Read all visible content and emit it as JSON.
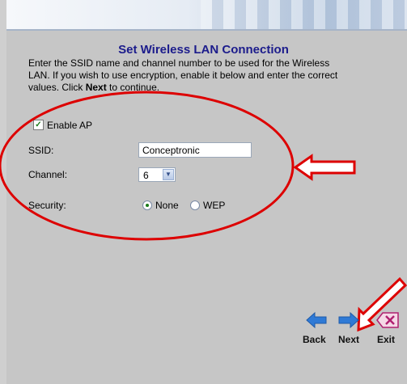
{
  "title": "Set Wireless LAN Connection",
  "description": {
    "line1": "Enter the SSID name and channel number to be used for the Wireless",
    "line2": "LAN. If you wish to use encryption, enable it below and enter the correct",
    "line3_before": "values. Click ",
    "line3_bold": "Next",
    "line3_after": " to continue."
  },
  "form": {
    "enable_ap": {
      "label": "Enable AP",
      "checked": true
    },
    "ssid": {
      "label": "SSID:",
      "value": "Conceptronic"
    },
    "channel": {
      "label": "Channel:",
      "value": "6"
    },
    "security": {
      "label": "Security:",
      "options": [
        "None",
        "WEP"
      ],
      "selected": "None"
    }
  },
  "nav": {
    "back": "Back",
    "next": "Next",
    "exit": "Exit"
  },
  "colors": {
    "title": "#1c1c8c",
    "annotation": "#dd0000",
    "panel": "#c6c6c6",
    "nav_arrow": "#2f7ad6"
  },
  "icons": {
    "back": "left-arrow-icon",
    "next": "right-arrow-icon",
    "exit": "exit-x-icon",
    "check": "checkmark-icon"
  }
}
